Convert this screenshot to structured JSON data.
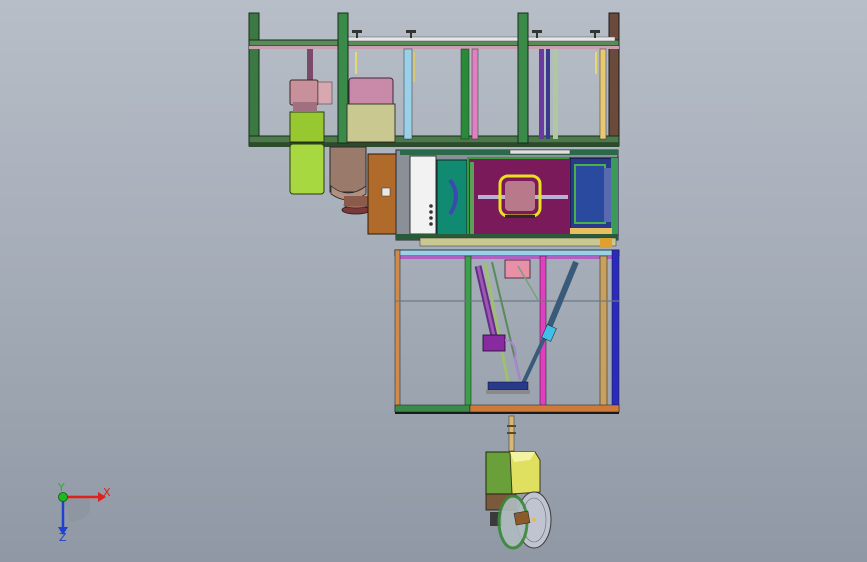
{
  "viewport": {
    "background": "#a9b1bb"
  },
  "triad": {
    "x_label": "X",
    "y_label": "Y",
    "z_label": "Z",
    "x_color": "#e0201c",
    "y_color": "#1fb81f",
    "z_color": "#2040d0"
  }
}
